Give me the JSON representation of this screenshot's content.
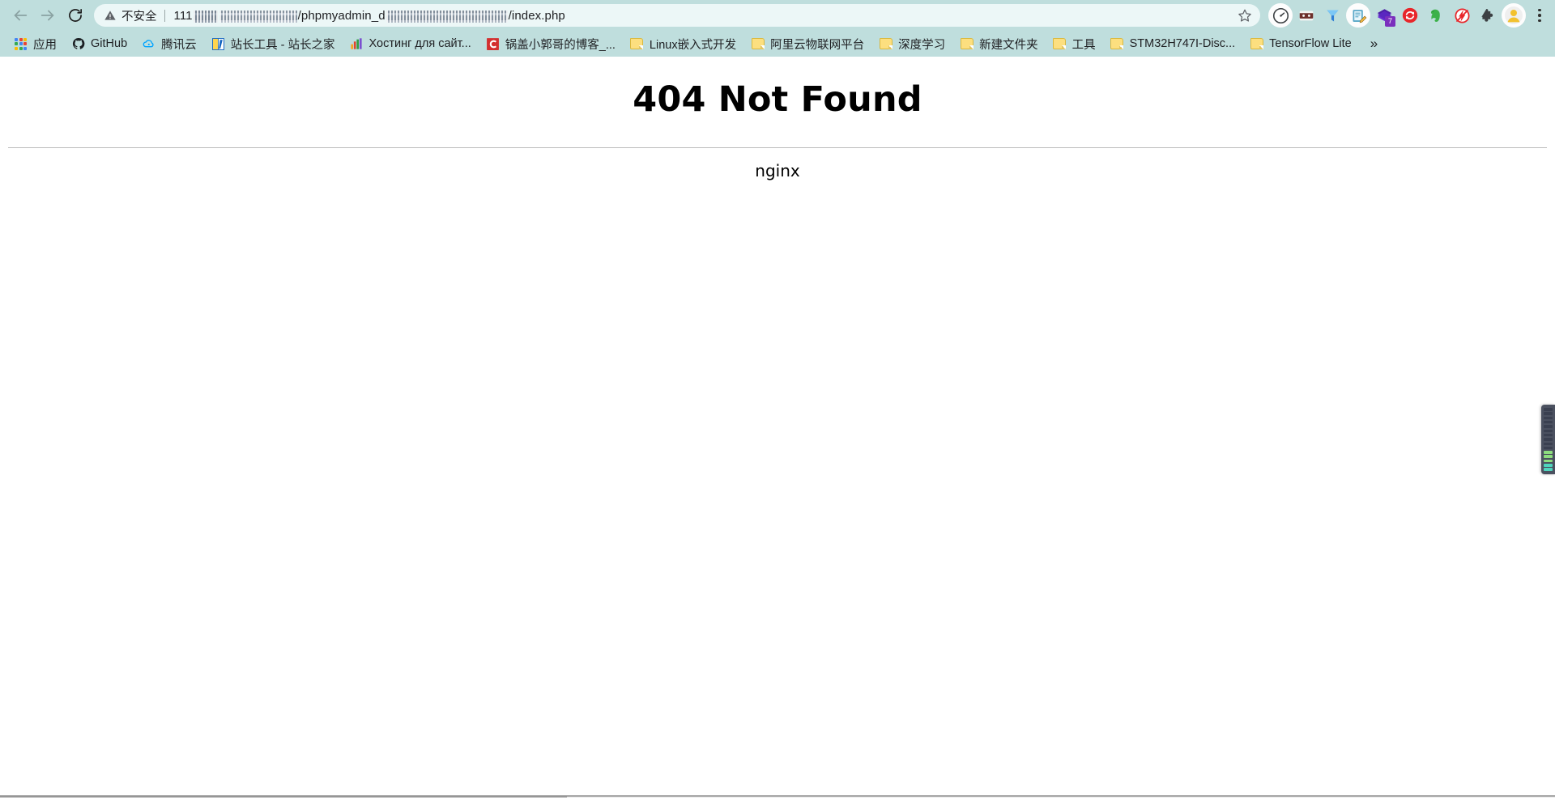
{
  "browser": {
    "nav": {
      "back_tooltip": "Back",
      "forward_tooltip": "Forward",
      "reload_tooltip": "Reload"
    },
    "omnibox": {
      "security_label": "不安全",
      "security_icon": "warning-triangle-icon",
      "url_prefix": "111",
      "url_mid": "/phpmyadmin_d",
      "url_suffix": "/index.php",
      "redacted": true,
      "bookmark_icon": "star-icon"
    },
    "extensions": [
      {
        "name": "speedometer-icon",
        "label": "Speed test"
      },
      {
        "name": "lastpass-mask-icon",
        "label": "LastPass"
      },
      {
        "name": "blue-funnel-icon",
        "label": "Blue funnel"
      },
      {
        "name": "notepad-pencil-icon",
        "label": "Notes"
      },
      {
        "name": "purple-stack-icon",
        "label": "Stack",
        "badge": "7"
      },
      {
        "name": "red-refresh-icon",
        "label": "Auto refresh"
      },
      {
        "name": "evernote-elephant-icon",
        "label": "Evernote"
      },
      {
        "name": "flash-blocker-icon",
        "label": "Flash blocker"
      },
      {
        "name": "puzzle-piece-icon",
        "label": "Extensions"
      },
      {
        "name": "profile-avatar-icon",
        "label": "Profile"
      },
      {
        "name": "three-dot-menu-icon",
        "label": "Customize and control Google Chrome"
      }
    ],
    "bookmarks": [
      {
        "label": "应用",
        "icon": "apps-grid-icon"
      },
      {
        "label": "GitHub",
        "icon": "github-icon"
      },
      {
        "label": "腾讯云",
        "icon": "tencent-cloud-icon"
      },
      {
        "label": "站长工具 - 站长之家",
        "icon": "chinaz-icon"
      },
      {
        "label": "Хостинг для сайт...",
        "icon": "bars-chart-icon"
      },
      {
        "label": "锅盖小郭哥的博客_...",
        "icon": "csdn-icon"
      },
      {
        "label": "Linux嵌入式开发",
        "icon": "folder-icon"
      },
      {
        "label": "阿里云物联网平台",
        "icon": "folder-icon"
      },
      {
        "label": "深度学习",
        "icon": "folder-icon"
      },
      {
        "label": "新建文件夹",
        "icon": "folder-icon"
      },
      {
        "label": "工具",
        "icon": "folder-icon"
      },
      {
        "label": "STM32H747I-Disc...",
        "icon": "folder-icon"
      },
      {
        "label": "TensorFlow Lite",
        "icon": "folder-icon"
      }
    ],
    "bookmarks_overflow": "»"
  },
  "page": {
    "title": "404 Not Found",
    "server": "nginx"
  },
  "widgets": {
    "edge_meter": {
      "name": "network-meter-widget",
      "segments_total": 15,
      "segments_active": 5
    }
  },
  "colors": {
    "chrome_bg": "#bfdedd",
    "omnibox_bg": "#ecf7f7",
    "page_bg": "#ffffff",
    "text": "#202124",
    "hr": "#bcbcbc",
    "meter_bg": "#4b5160",
    "meter_on": "#8ddd7e"
  }
}
